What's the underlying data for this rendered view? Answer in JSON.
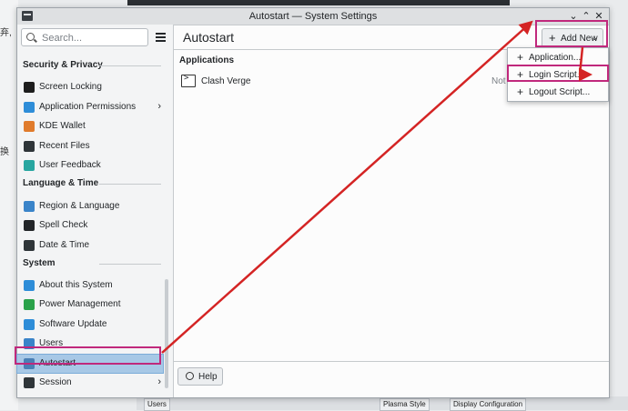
{
  "window": {
    "title": "Autostart — System Settings",
    "minimize": "⌄",
    "maximize": "⌃",
    "close": "✕"
  },
  "search": {
    "placeholder": "Search..."
  },
  "sidebar": {
    "sections": [
      {
        "label": "Security & Privacy"
      },
      {
        "label": "Language & Time"
      },
      {
        "label": "System"
      }
    ],
    "items": [
      {
        "label": "Screen Locking",
        "color": "#1d1d1d"
      },
      {
        "label": "Application Permissions",
        "color": "#2e8dd8",
        "chevron": "›"
      },
      {
        "label": "KDE Wallet",
        "color": "#e07b2c"
      },
      {
        "label": "Recent Files",
        "color": "#2f3539"
      },
      {
        "label": "User Feedback",
        "color": "#28a6a0"
      },
      {
        "label": "Region & Language",
        "color": "#3a84c9"
      },
      {
        "label": "Spell Check",
        "color": "#232629"
      },
      {
        "label": "Date & Time",
        "color": "#2f3539"
      },
      {
        "label": "About this System",
        "color": "#2e8dd8"
      },
      {
        "label": "Power Management",
        "color": "#2aa24a"
      },
      {
        "label": "Software Update",
        "color": "#2e8dd8"
      },
      {
        "label": "Users",
        "color": "#3a84c9"
      },
      {
        "label": "Autostart",
        "color": "#4a7fb5"
      },
      {
        "label": "Session",
        "color": "#2f3539",
        "chevron": "›"
      }
    ]
  },
  "main": {
    "title": "Autostart",
    "add_button": "Add New",
    "group_header": "Applications",
    "entries": [
      {
        "name": "Clash Verge",
        "status": "Not a"
      }
    ],
    "help_button": "Help"
  },
  "add_menu": {
    "items": [
      {
        "label": "Application..."
      },
      {
        "label": "Login Script..."
      },
      {
        "label": "Logout Script..."
      }
    ]
  },
  "background": {
    "left_chars": [
      "弃,",
      "换"
    ],
    "taskbar": [
      "Users",
      "Plasma Style",
      "Display Configuration"
    ]
  },
  "colors": {
    "annotation": "#c0287c",
    "arrow": "#d42424",
    "selection": "#a7c8e6"
  }
}
